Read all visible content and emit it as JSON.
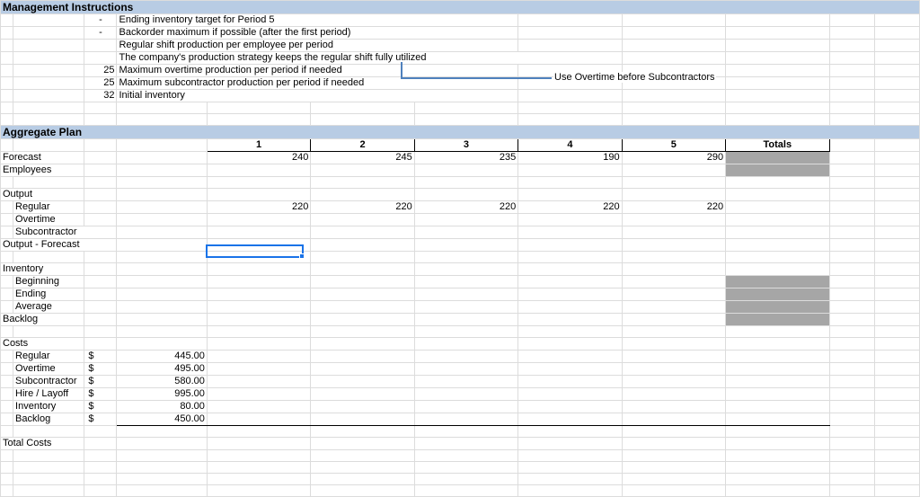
{
  "sections": {
    "mgmt_title": "Management Instructions",
    "agg_title": "Aggregate Plan"
  },
  "instructions": [
    {
      "val": "-",
      "text": "Ending inventory target for Period 5"
    },
    {
      "val": "-",
      "text": "Backorder maximum if possible (after the first period)"
    },
    {
      "val": "",
      "text": "Regular shift production per employee per period"
    },
    {
      "val": "",
      "text": "The company's production strategy keeps the regular shift fully utilized"
    },
    {
      "val": "25",
      "text": "Maximum overtime production per period if needed"
    },
    {
      "val": "25",
      "text": "Maximum subcontractor production per period if needed"
    },
    {
      "val": "32",
      "text": "Initial inventory"
    }
  ],
  "callout": "Use Overtime before Subcontractors",
  "plan": {
    "periods": [
      "1",
      "2",
      "3",
      "4",
      "5"
    ],
    "totals_label": "Totals",
    "rows": {
      "forecast": {
        "label": "Forecast",
        "v": [
          "240",
          "245",
          "235",
          "190",
          "290"
        ]
      },
      "employees": {
        "label": "Employees",
        "v": [
          "",
          "",
          "",
          "",
          ""
        ]
      },
      "output": {
        "label": "Output"
      },
      "regular": {
        "label": "Regular",
        "v": [
          "220",
          "220",
          "220",
          "220",
          "220"
        ]
      },
      "overtime": {
        "label": "Overtime",
        "v": [
          "",
          "",
          "",
          "",
          ""
        ]
      },
      "subcontractor": {
        "label": "Subcontractor",
        "v": [
          "",
          "",
          "",
          "",
          ""
        ]
      },
      "output_fc": {
        "label": "Output - Forecast",
        "v": [
          "",
          "",
          "",
          "",
          ""
        ]
      },
      "inventory": {
        "label": "Inventory"
      },
      "beginning": {
        "label": "Beginning",
        "v": [
          "",
          "",
          "",
          "",
          ""
        ]
      },
      "ending": {
        "label": "Ending",
        "v": [
          "",
          "",
          "",
          "",
          ""
        ]
      },
      "average": {
        "label": "Average",
        "v": [
          "",
          "",
          "",
          "",
          ""
        ]
      },
      "backlog": {
        "label": "Backlog",
        "v": [
          "",
          "",
          "",
          "",
          ""
        ]
      }
    }
  },
  "costs": {
    "label": "Costs",
    "currency": "$",
    "items": {
      "regular": {
        "label": "Regular",
        "amount": "445.00"
      },
      "overtime": {
        "label": "Overtime",
        "amount": "495.00"
      },
      "subcontractor": {
        "label": "Subcontractor",
        "amount": "580.00"
      },
      "hire_layoff": {
        "label": "Hire / Layoff",
        "amount": "995.00"
      },
      "inventory": {
        "label": "Inventory",
        "amount": "80.00"
      },
      "backlog": {
        "label": "Backlog",
        "amount": "450.00"
      }
    },
    "total_label": "Total Costs"
  }
}
